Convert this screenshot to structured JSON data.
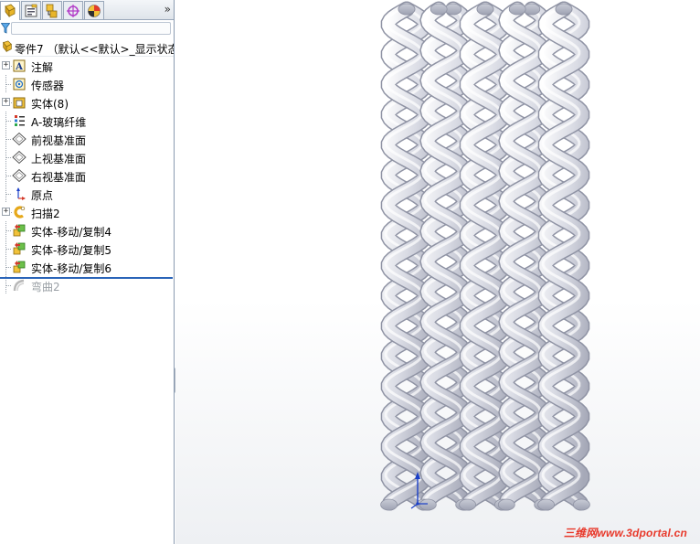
{
  "feature_manager": {
    "tabs": [
      {
        "name": "featuremanager-tree-icon",
        "active": true
      },
      {
        "name": "property-manager-icon",
        "active": false
      },
      {
        "name": "configuration-manager-icon",
        "active": false
      },
      {
        "name": "dimxpert-manager-icon",
        "active": false
      },
      {
        "name": "display-manager-icon",
        "active": false
      }
    ],
    "more_label": "»",
    "root_label": "零件7 （默认<<默认>_显示状态",
    "items": [
      {
        "label": "注解",
        "icon": "annotations-icon",
        "expandable": true,
        "suppressed": false
      },
      {
        "label": "传感器",
        "icon": "sensors-icon",
        "expandable": false,
        "suppressed": false
      },
      {
        "label": "实体(8)",
        "icon": "solid-bodies-folder-icon",
        "expandable": true,
        "suppressed": false
      },
      {
        "label": "A-玻璃纤维",
        "icon": "material-icon",
        "expandable": false,
        "suppressed": false
      },
      {
        "label": "前视基准面",
        "icon": "plane-icon",
        "expandable": false,
        "suppressed": false
      },
      {
        "label": "上视基准面",
        "icon": "plane-icon",
        "expandable": false,
        "suppressed": false
      },
      {
        "label": "右视基准面",
        "icon": "plane-icon",
        "expandable": false,
        "suppressed": false
      },
      {
        "label": "原点",
        "icon": "origin-icon",
        "expandable": false,
        "suppressed": false
      },
      {
        "label": "扫描2",
        "icon": "sweep-icon",
        "expandable": true,
        "suppressed": false
      },
      {
        "label": "实体-移动/复制4",
        "icon": "move-copy-body-icon",
        "expandable": false,
        "suppressed": false
      },
      {
        "label": "实体-移动/复制5",
        "icon": "move-copy-body-icon",
        "expandable": false,
        "suppressed": false
      },
      {
        "label": "实体-移动/复制6",
        "icon": "move-copy-body-icon",
        "expandable": false,
        "suppressed": false
      },
      {
        "label": "弯曲2",
        "icon": "flex-icon",
        "expandable": false,
        "suppressed": true
      }
    ]
  },
  "viewport": {
    "watermark": "三维网www.3dportal.cn",
    "model": "braided-strands-model",
    "triad": "triad-axis-icon"
  },
  "colors": {
    "rollback_bar": "#2a64b8",
    "watermark": "#e8382a",
    "strand": "#d6d8e2"
  }
}
